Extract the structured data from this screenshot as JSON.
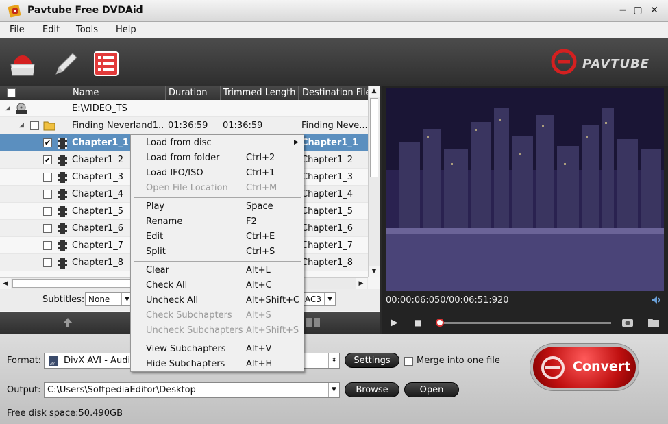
{
  "window": {
    "title": "Pavtube Free DVDAid",
    "min": "−",
    "max": "▢",
    "close": "✕"
  },
  "menu": [
    "File",
    "Edit",
    "Tools",
    "Help"
  ],
  "brand": "PAVTUBE",
  "columns": [
    "Name",
    "Duration",
    "Trimmed Length",
    "Destination File"
  ],
  "source": {
    "path": "E:\\VIDEO_TS"
  },
  "title_row": {
    "name": "Finding Neverland1...",
    "duration": "01:36:59",
    "trimmed": "01:36:59",
    "dest": "Finding Neve..."
  },
  "chapters": [
    {
      "name": "Chapter1_1",
      "dest": "Chapter1_1",
      "checked": true,
      "selected": true
    },
    {
      "name": "Chapter1_2",
      "dest": "Chapter1_2",
      "checked": true
    },
    {
      "name": "Chapter1_3",
      "dest": "Chapter1_3",
      "checked": false
    },
    {
      "name": "Chapter1_4",
      "dest": "Chapter1_4",
      "checked": false
    },
    {
      "name": "Chapter1_5",
      "dest": "Chapter1_5",
      "checked": false
    },
    {
      "name": "Chapter1_6",
      "dest": "Chapter1_6",
      "checked": false
    },
    {
      "name": "Chapter1_7",
      "dest": "Chapter1_7",
      "checked": false
    },
    {
      "name": "Chapter1_8",
      "dest": "Chapter1_8",
      "checked": false
    }
  ],
  "subtitles": {
    "label": "Subtitles:",
    "value": "None"
  },
  "audio": {
    "value": "AC3"
  },
  "context_menu": [
    {
      "label": "Load from disc",
      "shortcut": "",
      "submenu": true
    },
    {
      "label": "Load from folder",
      "shortcut": "Ctrl+2"
    },
    {
      "label": "Load IFO/ISO",
      "shortcut": "Ctrl+1"
    },
    {
      "label": "Open File Location",
      "shortcut": "Ctrl+M",
      "disabled": true
    },
    {
      "sep": true
    },
    {
      "label": "Play",
      "shortcut": "Space"
    },
    {
      "label": "Rename",
      "shortcut": "F2"
    },
    {
      "label": "Edit",
      "shortcut": "Ctrl+E"
    },
    {
      "label": "Split",
      "shortcut": "Ctrl+S"
    },
    {
      "sep": true
    },
    {
      "label": "Clear",
      "shortcut": "Alt+L"
    },
    {
      "label": "Check All",
      "shortcut": "Alt+C"
    },
    {
      "label": "Uncheck All",
      "shortcut": "Alt+Shift+C"
    },
    {
      "label": "Check Subchapters",
      "shortcut": "Alt+S",
      "disabled": true
    },
    {
      "label": "Uncheck Subchapters",
      "shortcut": "Alt+Shift+S",
      "disabled": true
    },
    {
      "sep": true
    },
    {
      "label": "View Subchapters",
      "shortcut": "Alt+V"
    },
    {
      "label": "Hide Subchapters",
      "shortcut": "Alt+H"
    }
  ],
  "preview": {
    "timecode": "00:00:06:050/00:06:51:920",
    "progress": 0.0
  },
  "bottom": {
    "format_label": "Format:",
    "format_value": "DivX AVI - Audio Video Interleaved(DivX)(*.avi)",
    "settings": "Settings",
    "merge": "Merge into one file",
    "output_label": "Output:",
    "output_value": "C:\\Users\\SoftpediaEditor\\Desktop",
    "browse": "Browse",
    "open": "Open",
    "free_space": "Free disk space:50.490GB",
    "convert": "Convert"
  },
  "colors": {
    "accent": "#c01010",
    "selection": "#5b8fbf"
  }
}
